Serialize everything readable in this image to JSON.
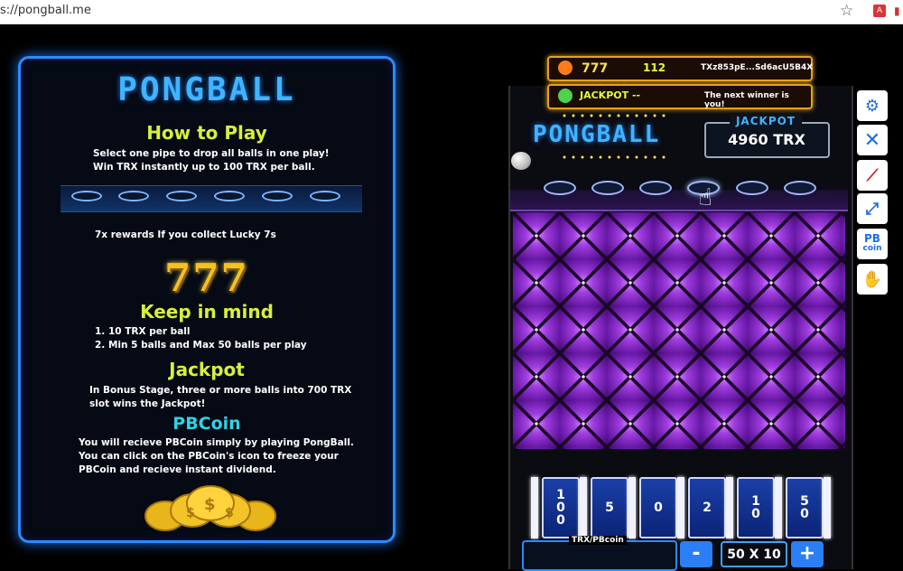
{
  "browser": {
    "url": "s://pongball.me"
  },
  "panel": {
    "logo": "PONGBALL",
    "how_title": "How to Play",
    "how_line1": "Select one pipe to drop all balls in one play!",
    "how_line2": "Win TRX instantly up to 100 TRX per ball.",
    "lucky": "7x rewards If you collect Lucky 7s",
    "sevens": "777",
    "mind_title": "Keep in mind",
    "mind_1": "1. 10 TRX per ball",
    "mind_2": "2. Min  5  balls and Max 50 balls per play",
    "jackpot_title": "Jackpot",
    "jackpot_line1": "In Bonus Stage, three or more balls into 700 TRX",
    "jackpot_line2": "slot wins the Jackpot!",
    "pbcoin_title": "PBCoin",
    "pbcoin_line1": "You will recieve PBCoin simply by playing PongBall.",
    "pbcoin_line2": "You can click on the PBCoin's icon to freeze your",
    "pbcoin_line3": "PBCoin and recieve instant dividend."
  },
  "game": {
    "info1_sevens": "777",
    "info1_count": "112",
    "info1_address": "TXz853pE...Sd6acU5B4X",
    "info2_label": "JACKPOT --",
    "info2_message": "The next winner is you!",
    "logo": "PONGBALL",
    "jackpot_label": "JACKPOT",
    "jackpot_value": "4960 TRX",
    "slots": [
      "1\n0\n0",
      "5",
      "0",
      "2",
      "1\n0",
      "5\n0"
    ],
    "bet_label": "TRX/PBcoin",
    "minus": "-",
    "plus": "+",
    "quantity": "50 X 10"
  },
  "sidebar": {
    "settings_icon": "gear-icon",
    "close_icon": "x-icon",
    "sound_icon": "mute-icon",
    "fullscreen_icon": "fullscreen-icon",
    "pbcoin_label_1": "PB",
    "pbcoin_label_2": "coin",
    "hand_icon": "hand-icon"
  },
  "colors": {
    "accent": "#2a8cff",
    "title_yellow": "#d8f03a",
    "title_cyan": "#2ed3e8",
    "board_purple": "#a13ee0"
  }
}
